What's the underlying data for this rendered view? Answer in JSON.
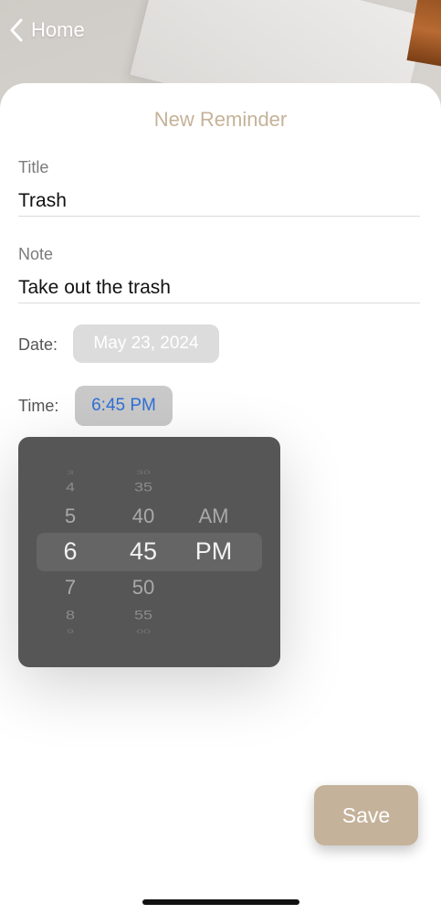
{
  "nav": {
    "back_label": "Home"
  },
  "sheet": {
    "title": "New Reminder"
  },
  "form": {
    "title_label": "Title",
    "title_value": "Trash",
    "note_label": "Note",
    "note_value": "Take out the trash",
    "date_label": "Date:",
    "date_value": "May 23, 2024",
    "time_label": "Time:",
    "time_value": "6:45 PM"
  },
  "picker": {
    "hours": [
      "3",
      "4",
      "5",
      "6",
      "7",
      "8",
      "9"
    ],
    "minutes": [
      "30",
      "35",
      "40",
      "45",
      "50",
      "55",
      "00"
    ],
    "periods": [
      "AM",
      "PM"
    ],
    "selected_hour": "6",
    "selected_minute": "45",
    "selected_period": "PM"
  },
  "actions": {
    "save_label": "Save"
  },
  "colors": {
    "accent": "#c5b29a",
    "title": "#c5b299",
    "time_text": "#2f6fd6",
    "picker_bg": "#565656"
  },
  "icons": {
    "back": "chevron-left-icon"
  }
}
